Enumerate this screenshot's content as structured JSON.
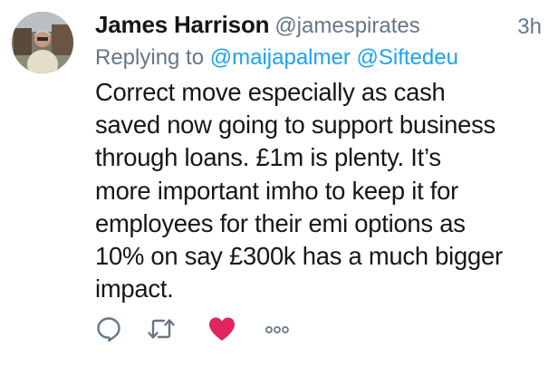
{
  "tweet": {
    "display_name": "James Harrison",
    "handle": "@jamespirates",
    "timestamp": "3h",
    "replying_to_label": "Replying to",
    "replying_to": [
      "@maijapalmer",
      "@Siftedeu"
    ],
    "text_lines": [
      "Correct move especially as cash",
      "saved now going to support business",
      "through loans. £1m is plenty. It’s",
      "more important imho to keep it for",
      "employees for their emi options as",
      "10% on say £300k has a much bigger",
      "impact."
    ]
  },
  "actions": {
    "icons": [
      "reply-icon",
      "retweet-icon",
      "like-icon",
      "more-icon"
    ],
    "liked": true
  },
  "colors": {
    "text": "#14171a",
    "secondary": "#657786",
    "link": "#1da1f2",
    "like": "#e0245e"
  }
}
